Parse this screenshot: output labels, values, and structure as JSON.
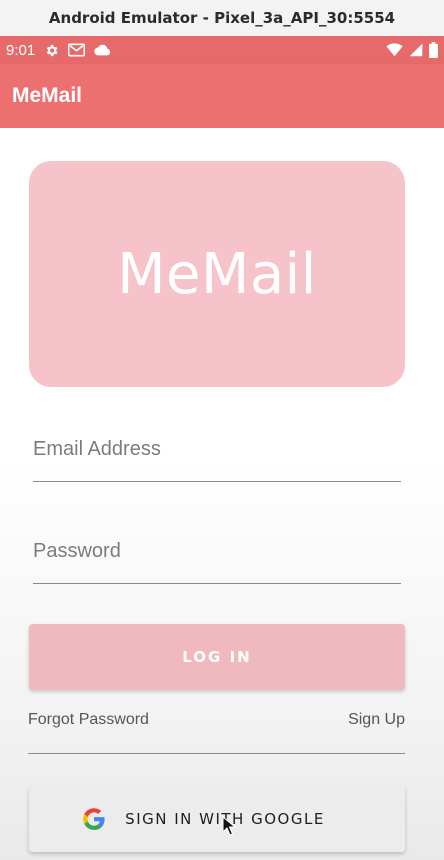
{
  "window": {
    "title": "Android Emulator - Pixel_3a_API_30:5554"
  },
  "status_bar": {
    "time": "9:01",
    "left_icons": [
      "gear-icon",
      "gmail-icon",
      "cloud-icon"
    ],
    "right_icons": [
      "wifi-icon",
      "cell-signal-icon",
      "battery-icon"
    ]
  },
  "app_bar": {
    "title": "MeMail"
  },
  "logo": {
    "text": "MeMail"
  },
  "form": {
    "email_placeholder": "Email Address",
    "password_placeholder": "Password",
    "login_label": "LOG IN",
    "forgot_label": "Forgot Password",
    "signup_label": "Sign Up",
    "google_label": "SIGN IN WITH GOOGLE"
  },
  "colors": {
    "status_bar": "#e76a6a",
    "app_bar": "#ec7070",
    "logo_card": "#f5c3c9",
    "login_button": "#f0b8bf",
    "google_button": "#ececec"
  }
}
